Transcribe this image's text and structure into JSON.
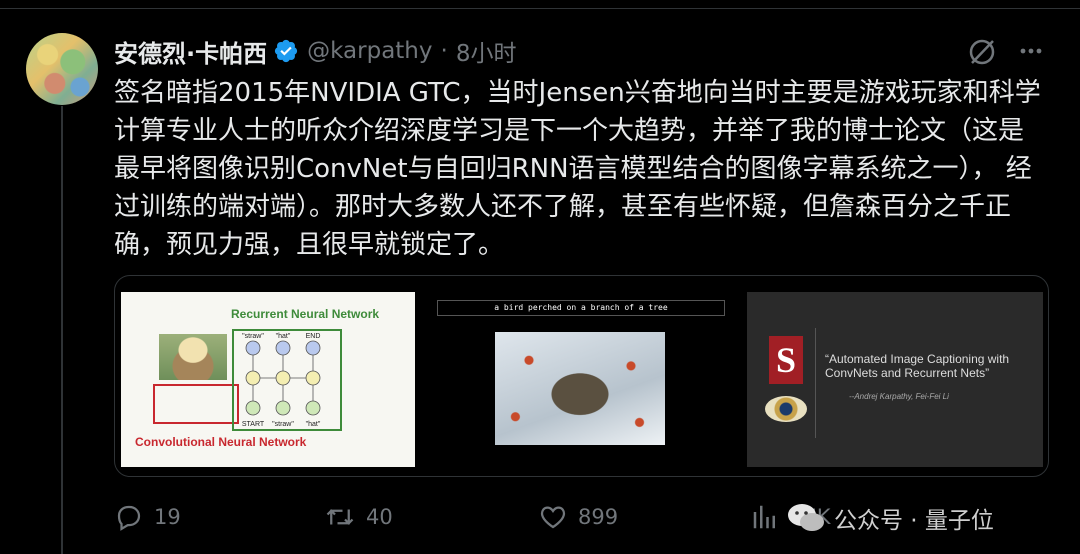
{
  "author": {
    "display_name": "安德烈·卡帕西",
    "handle": "@karpathy",
    "separator": "·",
    "time": "8小时"
  },
  "tweet": {
    "text": "签名暗指2015年NVIDIA GTC，当时Jensen兴奋地向当时主要是游戏玩家和科学计算专业人士的听众介绍深度学习是下一个大趋势，并举了我的博士论文（这是最早将图像识别ConvNet与自回归RNN语言模型结合的图像字幕系统之一）， 经过训练的端对端）。那时大多数人还不了解，甚至有些怀疑，但詹森百分之千正确，预见力强，且很早就锁定了。"
  },
  "media": {
    "panel1": {
      "rnn_title": "Recurrent Neural Network",
      "cnn_title": "Convolutional Neural Network",
      "top_words": [
        "\"straw\"",
        "\"hat\"",
        "END"
      ],
      "bottom_words": [
        "START",
        "\"straw\"",
        "\"hat\""
      ]
    },
    "panel2": {
      "caption": "a bird perched on a branch of a tree"
    },
    "panel3": {
      "title": "“Automated Image Captioning with ConvNets and Recurrent Nets”",
      "author": "--Andrej Karpathy, Fei-Fei Li"
    }
  },
  "actions": {
    "replies": "19",
    "retweets": "40",
    "likes": "899",
    "views": "47K"
  },
  "watermark": {
    "text": "公众号 · 量子位"
  },
  "colors": {
    "background": "#000000",
    "text": "#e7e9ea",
    "muted": "#71767b",
    "verified": "#1d9bf0",
    "divider": "#2f3336"
  }
}
